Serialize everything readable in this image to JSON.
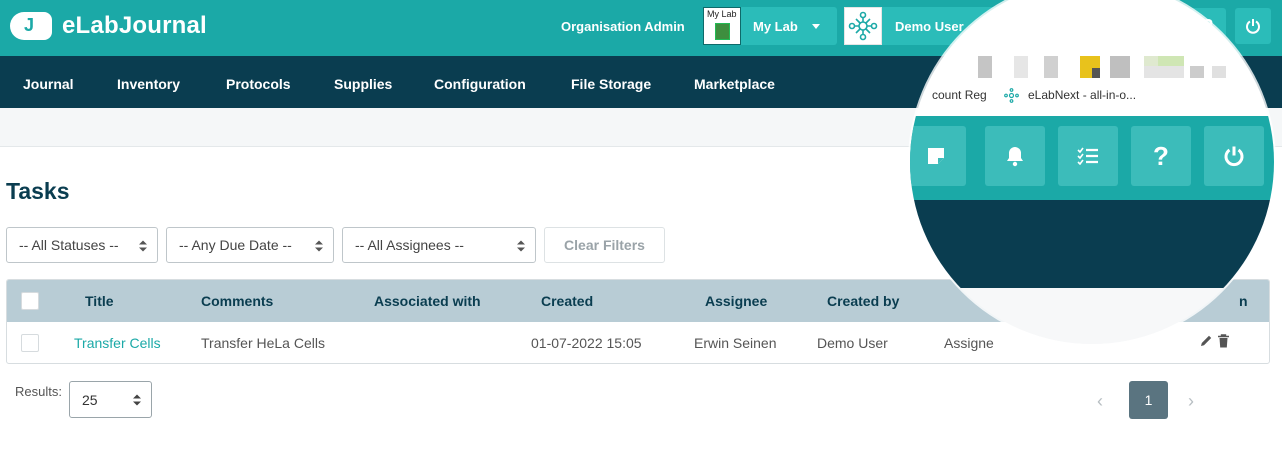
{
  "header": {
    "app_name": "eLabJournal",
    "org_admin_label": "Organisation Admin",
    "lab_thumb_label": "My Lab",
    "lab_label": "My Lab",
    "user_label": "Demo User",
    "brand_color": "#1ba9a7",
    "nav_color": "#0a3d50"
  },
  "nav": {
    "items": [
      "Journal",
      "Inventory",
      "Protocols",
      "Supplies",
      "Configuration",
      "File Storage",
      "Marketplace"
    ]
  },
  "page": {
    "title": "Tasks"
  },
  "filters": {
    "status": "-- All Statuses --",
    "due_date": "-- Any Due Date --",
    "assignees": "-- All Assignees --",
    "clear_label": "Clear Filters"
  },
  "table": {
    "columns": [
      "Title",
      "Comments",
      "Associated with",
      "Created",
      "Assignee",
      "Created by"
    ],
    "last_column_fragment": "n",
    "rows": [
      {
        "title": "Transfer Cells",
        "comments": "Transfer HeLa Cells",
        "associated_with": "",
        "created": "01-07-2022 15:05",
        "assignee": "Erwin Seinen",
        "created_by": "Demo User",
        "status_fragment": "Assigne"
      }
    ]
  },
  "pagination": {
    "results_label": "Results:",
    "page_size": "25",
    "current_page": "1",
    "prev_glyph": "‹",
    "next_glyph": "›"
  },
  "magnifier": {
    "bookmark_1": "count Reg",
    "bookmark_2": "eLabNext - all-in-o...",
    "buttons": [
      "sticky-note-icon",
      "bell-icon",
      "checklist-icon",
      "help-icon",
      "power-icon"
    ],
    "help_glyph": "?"
  }
}
